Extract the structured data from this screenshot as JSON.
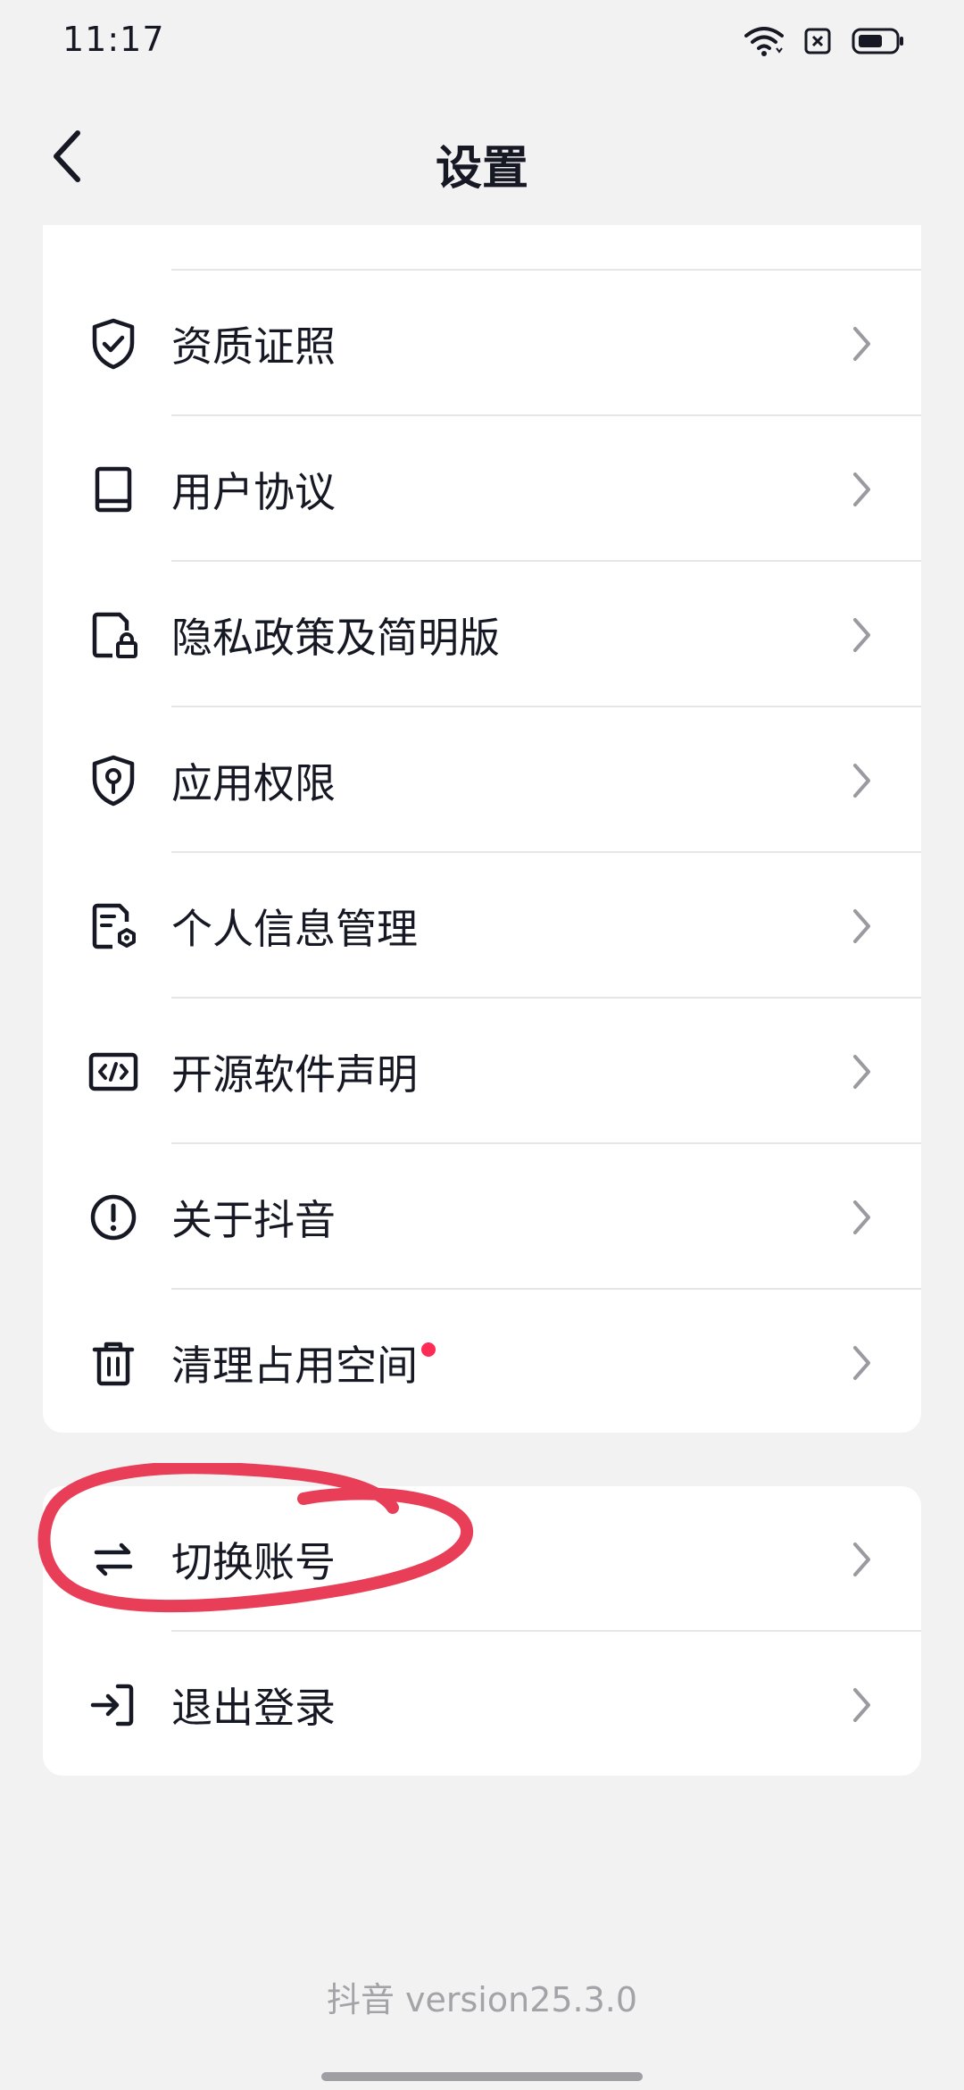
{
  "status_bar": {
    "time": "11:17"
  },
  "nav": {
    "title": "设置",
    "back_icon": "chevron-left-icon"
  },
  "section1": {
    "items": [
      {
        "label": "资质证照",
        "icon": "shield-check-icon"
      },
      {
        "label": "用户协议",
        "icon": "book-icon"
      },
      {
        "label": "隐私政策及简明版",
        "icon": "document-lock-icon"
      },
      {
        "label": "应用权限",
        "icon": "shield-key-icon"
      },
      {
        "label": "个人信息管理",
        "icon": "document-gear-icon"
      },
      {
        "label": "开源软件声明",
        "icon": "code-icon"
      },
      {
        "label": "关于抖音",
        "icon": "info-circle-icon"
      },
      {
        "label": "清理占用空间",
        "icon": "trash-icon",
        "badge": "red-dot"
      }
    ]
  },
  "section2": {
    "items": [
      {
        "label": "切换账号",
        "icon": "switch-arrows-icon"
      },
      {
        "label": "退出登录",
        "icon": "logout-icon"
      }
    ]
  },
  "footer": {
    "version": "抖音 version25.3.0"
  },
  "colors": {
    "background": "#f2f2f3",
    "card": "#ffffff",
    "text": "#161823",
    "badge": "#fe2c55",
    "annotation": "#e8344f"
  }
}
